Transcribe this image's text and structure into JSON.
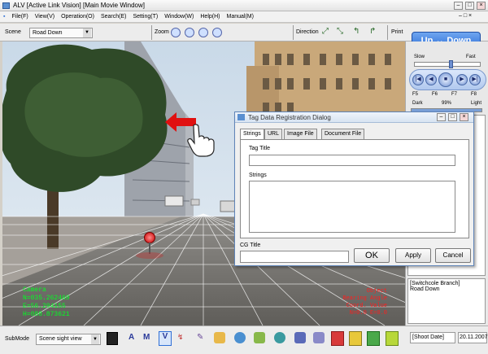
{
  "window": {
    "title": "ALV [Active Link Vision]    [Main Movie Window]"
  },
  "menu": [
    "File(F)",
    "View(V)",
    "Operation(O)",
    "Search(E)",
    "Setting(T)",
    "Window(W)",
    "Help(H)",
    "Manual(M)"
  ],
  "toolbar": {
    "scene_label": "Scene",
    "scene_value": "Road Down",
    "zoom_label": "Zoom",
    "direction_label": "Direction",
    "print_label": "Print",
    "updown_label": "Up ↔ Down"
  },
  "speed": {
    "slow": "Slow",
    "fast": "Fast"
  },
  "fkeys": [
    "F5",
    "F6",
    "F7",
    "F8"
  ],
  "brightness": {
    "dark": "Dark",
    "value": "99%",
    "light": "Light"
  },
  "overlay_green": [
    "Camera",
    "N=035.262469",
    "E=56.294155",
    "H=088.873621"
  ],
  "overlay_red": [
    "Object",
    "Bearing Angle",
    "Coord. Value",
    "N=0.0 E=0.0"
  ],
  "dialog": {
    "title": "Tag Data Registration Dialog",
    "tabs": [
      "Strings",
      "URL",
      "Image File",
      "Document File"
    ],
    "tag_title_label": "Tag Title",
    "strings_label": "Strings",
    "cg_title_label": "CG Title",
    "ok": "OK",
    "apply": "Apply",
    "cancel": "Cancel"
  },
  "info": {
    "branch": "[Switchcole Branch]",
    "branch_value": "Road Down",
    "shoot_date_label": "[Shoot Date]",
    "shoot_date_value": "20.11.2007"
  },
  "bottom": {
    "submode_label": "SubMode",
    "submode_value": "Scene sight view"
  },
  "colors": {
    "accent": "#2f6fd6",
    "green_text": "#00ff22",
    "red_text": "#ff1e1e"
  }
}
